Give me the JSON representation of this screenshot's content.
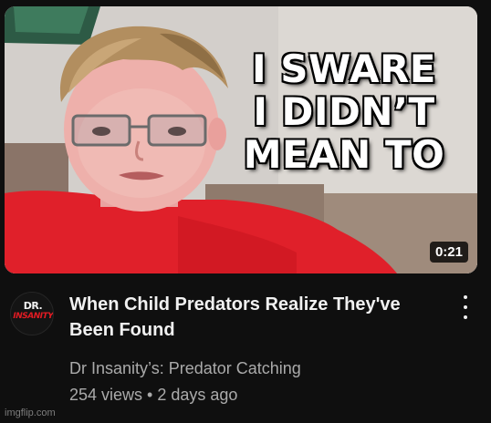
{
  "thumbnail": {
    "caption": "I SWARE\nI DIDN’T\nMEAN TO",
    "duration": "0:21"
  },
  "video": {
    "title": "When Child Predators Realize They've Been Found",
    "channel": "Dr Insanity’s: Predator Catching",
    "views": "254 views",
    "separator": "•",
    "age": "2 days ago"
  },
  "avatar": {
    "line1": "DR.",
    "line2": "INSANITY"
  },
  "menu": {
    "icon": "vertical-ellipsis-icon"
  },
  "watermark": "imgflip.com",
  "colors": {
    "background": "#0f0f0f",
    "title_text": "#f1f1f1",
    "secondary_text": "#aaaaaa",
    "shirt_red": "#e0202a"
  }
}
